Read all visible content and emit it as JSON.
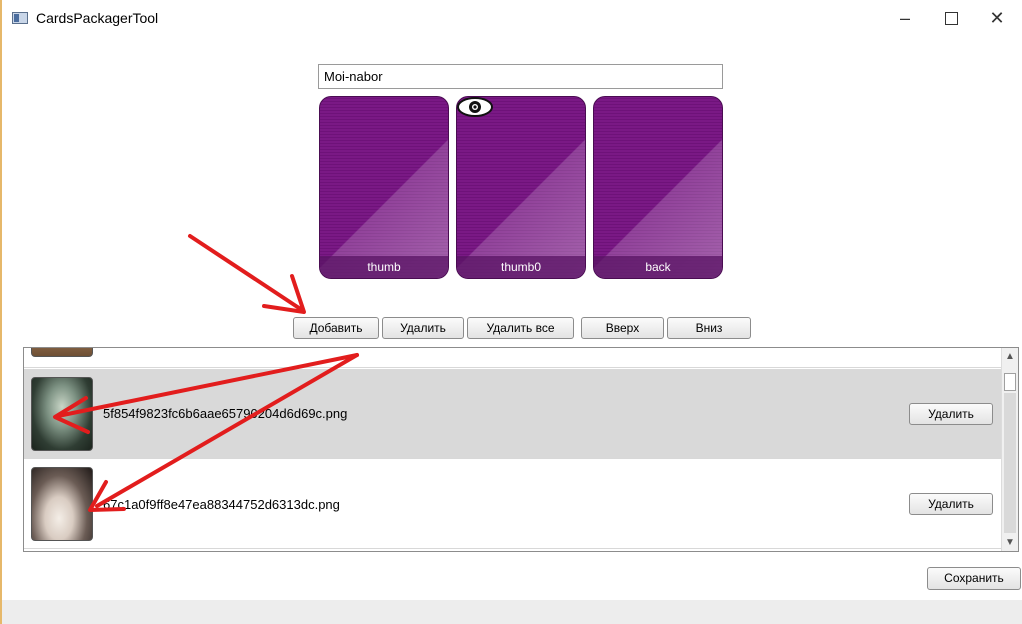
{
  "window": {
    "title": "CardsPackagerTool",
    "min_glyph": "–",
    "close_glyph": "✕"
  },
  "set_name": {
    "value": "Moi-nabor"
  },
  "cards": [
    {
      "label": "thumb",
      "icon": "card-image",
      "preview_marker": false
    },
    {
      "label": "thumb0",
      "icon": "card-image",
      "preview_marker": true
    },
    {
      "label": "back",
      "icon": "card-image",
      "preview_marker": false
    }
  ],
  "toolbar": {
    "add": "Добавить",
    "delete": "Удалить",
    "delete_all": "Удалить все",
    "up": "Вверх",
    "down": "Вниз"
  },
  "list": {
    "items": [
      {
        "filename": "",
        "selected": false,
        "delete_label": ""
      },
      {
        "filename": "5f854f9823fc6b6aae65790204d6d69c.png",
        "selected": true,
        "delete_label": "Удалить"
      },
      {
        "filename": "67c1a0f9ff8e47ea88344752d6313dc.png",
        "selected": false,
        "delete_label": "Удалить"
      }
    ],
    "scroll_up_glyph": "▲",
    "scroll_down_glyph": "▼"
  },
  "save": "Сохранить",
  "annotation_color": "#e21d1d"
}
